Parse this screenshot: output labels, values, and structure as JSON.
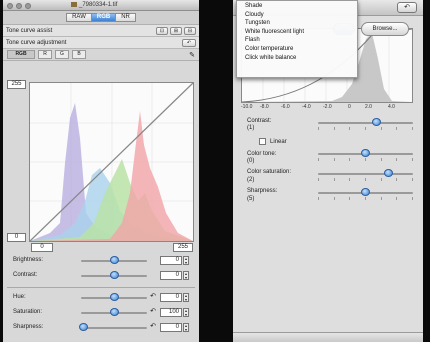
{
  "left_window": {
    "title": "_7980334-1.tif",
    "mode_tabs": [
      {
        "label": "RAW",
        "active": false
      },
      {
        "label": "RGB",
        "active": true
      },
      {
        "label": "NR",
        "active": false
      }
    ],
    "tone_curve_assist": "Tone curve assist",
    "tone_curve_adjustment": "Tone curve adjustment",
    "channel_tabs": [
      {
        "label": "RGB",
        "selected": true
      },
      {
        "label": "R",
        "selected": false
      },
      {
        "label": "G",
        "selected": false
      },
      {
        "label": "B",
        "selected": false
      }
    ],
    "output_max": "255",
    "output_min": "0",
    "input_min": "0",
    "input_max": "255",
    "adjustments_top": [
      {
        "label": "Brightness:",
        "value": "0",
        "level": 0.5
      },
      {
        "label": "Contrast:",
        "value": "0",
        "level": 0.5
      }
    ],
    "adjustments_bottom": [
      {
        "label": "Hue:",
        "value": "0",
        "level": 0.5
      },
      {
        "label": "Saturation:",
        "value": "100",
        "level": 0.5
      },
      {
        "label": "Sharpness:",
        "value": "0",
        "level": 0.0
      }
    ]
  },
  "right_window": {
    "browse_label": "Browse...",
    "axis_ticks": [
      "-10.0",
      "-8.0",
      "-6.0",
      "-4.0",
      "-2.0",
      "0",
      "2.0",
      "4.0"
    ],
    "controls": [
      {
        "label": "Contrast:",
        "sub": "(1)",
        "level": 0.67
      },
      {
        "label": "Color tone:",
        "sub": "(0)",
        "level": 0.5
      },
      {
        "label": "Color saturation:",
        "sub": "(2)",
        "level": 0.83
      },
      {
        "label": "Sharpness:",
        "sub": "(5)",
        "level": 0.5
      }
    ],
    "linear_label": "Linear"
  },
  "wb_menu": {
    "items": [
      "Shade",
      "Cloudy",
      "Tungsten",
      "White fluorescent light",
      "Flash",
      "Color temperature",
      "Click white balance"
    ]
  },
  "colors": {
    "accent_blue": "#3d7fd3",
    "histogram_red": "#f2a4a8",
    "histogram_green": "#b9e2a6",
    "histogram_blue": "#a9d2ec",
    "histogram_purple": "#b6aadf"
  }
}
